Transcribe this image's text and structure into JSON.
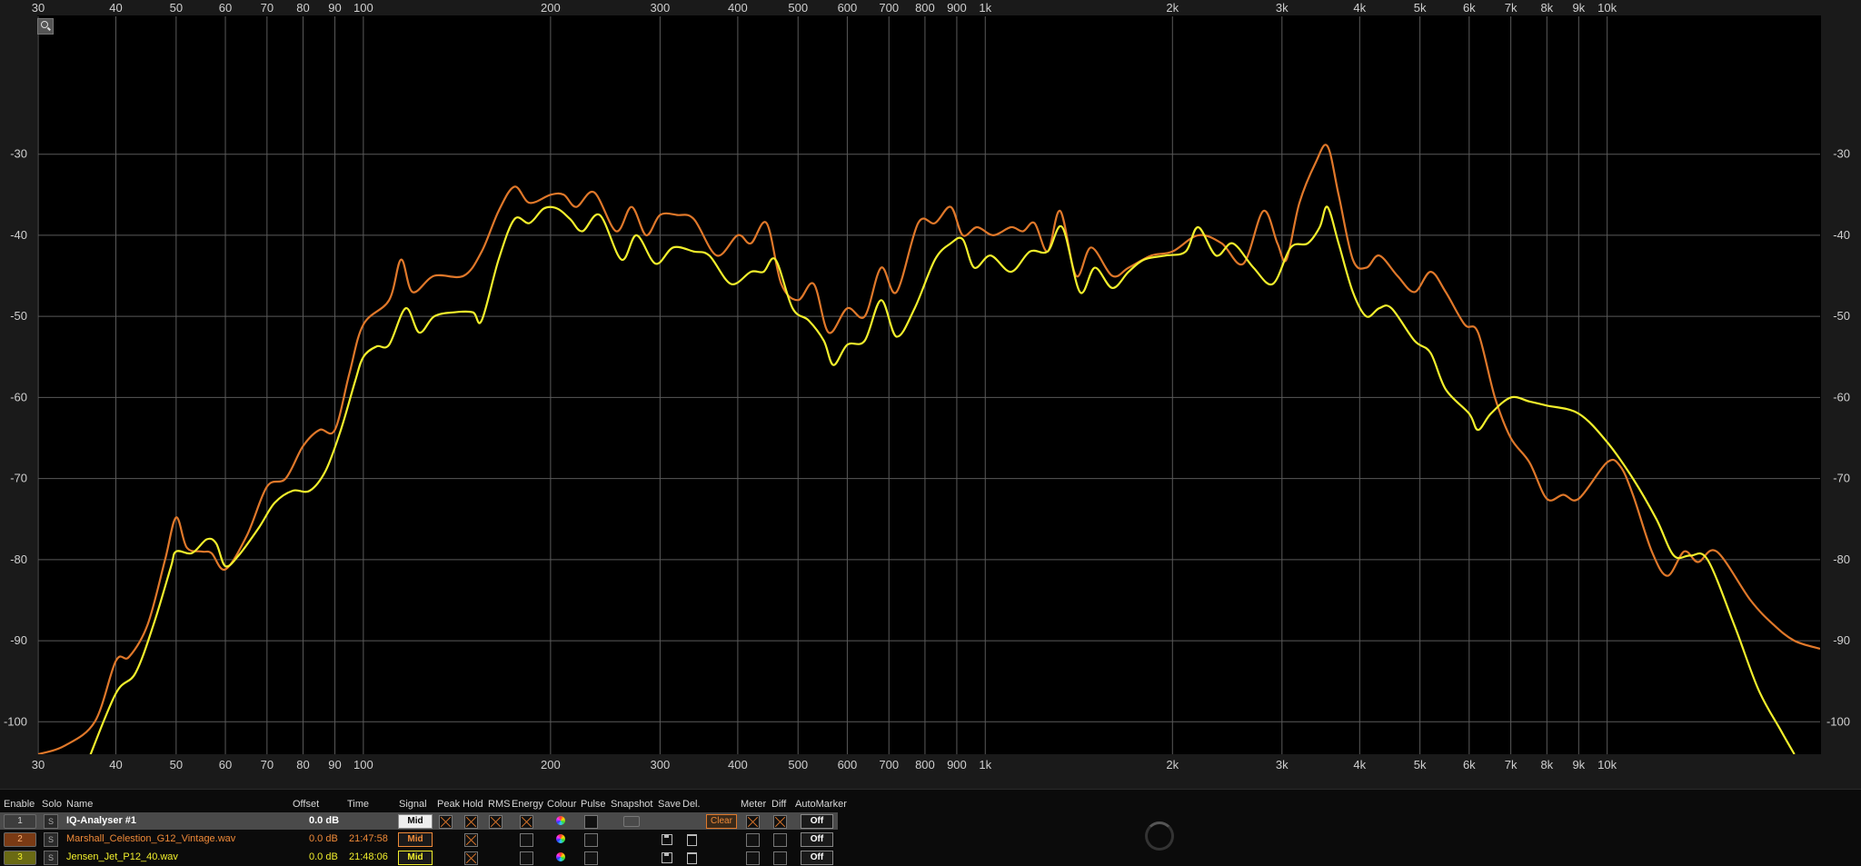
{
  "chart_data": {
    "type": "line",
    "x_scale": "log",
    "xlim": [
      30,
      22000
    ],
    "ylim": [
      -104,
      -13
    ],
    "grid": true,
    "x_ticks": [
      30,
      40,
      50,
      60,
      70,
      80,
      90,
      100,
      200,
      300,
      400,
      500,
      600,
      700,
      800,
      900,
      1000,
      2000,
      3000,
      4000,
      5000,
      6000,
      7000,
      8000,
      9000,
      10000
    ],
    "x_tick_labels": [
      "30",
      "40",
      "50",
      "60",
      "70",
      "80",
      "90",
      "100",
      "200",
      "300",
      "400",
      "500",
      "600",
      "700",
      "800",
      "900",
      "1k",
      "2k",
      "3k",
      "4k",
      "5k",
      "6k",
      "7k",
      "8k",
      "9k",
      "10k"
    ],
    "y_ticks": [
      -30,
      -40,
      -50,
      -60,
      -70,
      -80,
      -90,
      -100
    ],
    "y_tick_labels": [
      "-30",
      "-40",
      "-50",
      "-60",
      "-70",
      "-80",
      "-90",
      "-100"
    ],
    "series": [
      {
        "name": "Marshall_Celestion_G12_Vintage.wav",
        "color": "#e0782a",
        "points": [
          [
            30,
            -104
          ],
          [
            33,
            -103
          ],
          [
            37,
            -100
          ],
          [
            40,
            -92.5
          ],
          [
            42,
            -92
          ],
          [
            45,
            -88
          ],
          [
            48,
            -80
          ],
          [
            50,
            -74.8
          ],
          [
            52,
            -78.5
          ],
          [
            55,
            -79
          ],
          [
            57,
            -79.2
          ],
          [
            60,
            -81.2
          ],
          [
            65,
            -77
          ],
          [
            70,
            -71
          ],
          [
            75,
            -70
          ],
          [
            80,
            -66
          ],
          [
            85,
            -64
          ],
          [
            90,
            -64
          ],
          [
            95,
            -57
          ],
          [
            100,
            -51
          ],
          [
            110,
            -48
          ],
          [
            115,
            -43
          ],
          [
            120,
            -47
          ],
          [
            130,
            -45
          ],
          [
            145,
            -45
          ],
          [
            155,
            -42
          ],
          [
            165,
            -37
          ],
          [
            175,
            -34
          ],
          [
            185,
            -36
          ],
          [
            200,
            -35
          ],
          [
            210,
            -35
          ],
          [
            220,
            -36.5
          ],
          [
            235,
            -34.7
          ],
          [
            255,
            -39.5
          ],
          [
            270,
            -36.5
          ],
          [
            285,
            -40
          ],
          [
            300,
            -37.5
          ],
          [
            320,
            -37.5
          ],
          [
            340,
            -38
          ],
          [
            370,
            -42.5
          ],
          [
            400,
            -40
          ],
          [
            420,
            -41
          ],
          [
            445,
            -38.5
          ],
          [
            470,
            -46
          ],
          [
            500,
            -48
          ],
          [
            530,
            -46
          ],
          [
            560,
            -52
          ],
          [
            600,
            -49
          ],
          [
            640,
            -50
          ],
          [
            680,
            -44
          ],
          [
            720,
            -47
          ],
          [
            780,
            -38.5
          ],
          [
            830,
            -38.5
          ],
          [
            880,
            -36.5
          ],
          [
            920,
            -40
          ],
          [
            970,
            -39
          ],
          [
            1030,
            -40
          ],
          [
            1100,
            -39
          ],
          [
            1150,
            -39.5
          ],
          [
            1200,
            -38.5
          ],
          [
            1260,
            -42
          ],
          [
            1320,
            -37
          ],
          [
            1400,
            -45
          ],
          [
            1480,
            -41.5
          ],
          [
            1600,
            -45
          ],
          [
            1700,
            -44
          ],
          [
            1850,
            -42.5
          ],
          [
            2000,
            -42
          ],
          [
            2200,
            -40
          ],
          [
            2400,
            -41
          ],
          [
            2600,
            -43.5
          ],
          [
            2800,
            -37
          ],
          [
            2950,
            -41
          ],
          [
            3050,
            -43
          ],
          [
            3200,
            -36
          ],
          [
            3400,
            -31
          ],
          [
            3550,
            -29
          ],
          [
            3700,
            -35
          ],
          [
            3900,
            -43
          ],
          [
            4100,
            -44
          ],
          [
            4300,
            -42.5
          ],
          [
            4600,
            -45
          ],
          [
            4900,
            -47
          ],
          [
            5200,
            -44.5
          ],
          [
            5500,
            -47
          ],
          [
            5900,
            -51
          ],
          [
            6200,
            -52
          ],
          [
            6600,
            -60
          ],
          [
            7000,
            -65
          ],
          [
            7500,
            -68
          ],
          [
            8000,
            -72.5
          ],
          [
            8500,
            -72
          ],
          [
            9000,
            -72.5
          ],
          [
            10000,
            -68
          ],
          [
            10500,
            -68.5
          ],
          [
            11000,
            -72
          ],
          [
            11800,
            -79
          ],
          [
            12500,
            -82
          ],
          [
            13300,
            -79
          ],
          [
            14000,
            -80.3
          ],
          [
            15000,
            -79
          ],
          [
            17000,
            -85
          ],
          [
            18500,
            -88
          ],
          [
            20000,
            -90
          ],
          [
            22000,
            -91
          ]
        ]
      },
      {
        "name": "Jensen_Jet_P12_40.wav",
        "color": "#f2ef2c",
        "points": [
          [
            36,
            -105
          ],
          [
            40,
            -96.5
          ],
          [
            43,
            -94
          ],
          [
            46,
            -88
          ],
          [
            49,
            -81
          ],
          [
            50,
            -79
          ],
          [
            53,
            -79.2
          ],
          [
            56,
            -77.5
          ],
          [
            58,
            -78
          ],
          [
            60,
            -80.8
          ],
          [
            63,
            -79.5
          ],
          [
            68,
            -76
          ],
          [
            72,
            -73
          ],
          [
            77,
            -71.5
          ],
          [
            82,
            -71.5
          ],
          [
            87,
            -69
          ],
          [
            92,
            -64
          ],
          [
            97,
            -58
          ],
          [
            100,
            -55
          ],
          [
            105,
            -53.7
          ],
          [
            110,
            -53.5
          ],
          [
            117,
            -49
          ],
          [
            123,
            -52
          ],
          [
            130,
            -50
          ],
          [
            140,
            -49.5
          ],
          [
            150,
            -49.5
          ],
          [
            155,
            -50.5
          ],
          [
            165,
            -43
          ],
          [
            175,
            -38
          ],
          [
            185,
            -38.5
          ],
          [
            195,
            -36.7
          ],
          [
            205,
            -36.7
          ],
          [
            215,
            -38
          ],
          [
            225,
            -39.5
          ],
          [
            240,
            -37.5
          ],
          [
            260,
            -43
          ],
          [
            275,
            -40
          ],
          [
            295,
            -43.5
          ],
          [
            315,
            -41.5
          ],
          [
            340,
            -42
          ],
          [
            360,
            -42.5
          ],
          [
            390,
            -46
          ],
          [
            420,
            -44.5
          ],
          [
            440,
            -44.5
          ],
          [
            460,
            -43
          ],
          [
            490,
            -49
          ],
          [
            520,
            -50.5
          ],
          [
            550,
            -53
          ],
          [
            570,
            -56
          ],
          [
            600,
            -53.5
          ],
          [
            640,
            -53
          ],
          [
            680,
            -48
          ],
          [
            720,
            -52.5
          ],
          [
            770,
            -49
          ],
          [
            830,
            -43
          ],
          [
            880,
            -41
          ],
          [
            920,
            -40.5
          ],
          [
            960,
            -44
          ],
          [
            1020,
            -42.5
          ],
          [
            1100,
            -44.5
          ],
          [
            1180,
            -42
          ],
          [
            1260,
            -42
          ],
          [
            1330,
            -39
          ],
          [
            1420,
            -47
          ],
          [
            1500,
            -44
          ],
          [
            1600,
            -46.5
          ],
          [
            1700,
            -44.5
          ],
          [
            1800,
            -43
          ],
          [
            1950,
            -42.5
          ],
          [
            2100,
            -42
          ],
          [
            2200,
            -39
          ],
          [
            2350,
            -42.5
          ],
          [
            2500,
            -41
          ],
          [
            2700,
            -44
          ],
          [
            2900,
            -46
          ],
          [
            3100,
            -41.5
          ],
          [
            3300,
            -41
          ],
          [
            3450,
            -39
          ],
          [
            3550,
            -36.5
          ],
          [
            3700,
            -41
          ],
          [
            3900,
            -47
          ],
          [
            4100,
            -50
          ],
          [
            4300,
            -49
          ],
          [
            4500,
            -49
          ],
          [
            4900,
            -53
          ],
          [
            5200,
            -54.5
          ],
          [
            5500,
            -59
          ],
          [
            6000,
            -62
          ],
          [
            6200,
            -64
          ],
          [
            6500,
            -62
          ],
          [
            7000,
            -60
          ],
          [
            7500,
            -60.5
          ],
          [
            8000,
            -61
          ],
          [
            9000,
            -62
          ],
          [
            10000,
            -65.5
          ],
          [
            11000,
            -70
          ],
          [
            12000,
            -75
          ],
          [
            12800,
            -79.5
          ],
          [
            13600,
            -79.5
          ],
          [
            14500,
            -80
          ],
          [
            16000,
            -88
          ],
          [
            17500,
            -96
          ],
          [
            19000,
            -101
          ],
          [
            20000,
            -104
          ]
        ]
      }
    ]
  },
  "panel": {
    "headers": {
      "enable": "Enable",
      "solo": "Solo",
      "name": "Name",
      "offset": "Offset",
      "time": "Time",
      "signal": "Signal",
      "peak": "Peak",
      "hold": "Hold",
      "rms": "RMS",
      "energy": "Energy",
      "colour": "Colour",
      "pulse": "Pulse",
      "snapshot": "Snapshot",
      "save": "Save",
      "del": "Del.",
      "meter": "Meter",
      "diff": "Diff",
      "automarker": "AutoMarker"
    },
    "rows": [
      {
        "index": "1",
        "solo": "S",
        "name": "IQ-Analyser #1",
        "offset": "0.0 dB",
        "time": "",
        "signal": "Mid",
        "clear": "Clear",
        "automarker": "Off",
        "color": "#ffffff"
      },
      {
        "index": "2",
        "solo": "S",
        "name": "Marshall_Celestion_G12_Vintage.wav",
        "offset": "0.0 dB",
        "time": "21:47:58",
        "signal": "Mid",
        "automarker": "Off",
        "color": "#f08a38"
      },
      {
        "index": "3",
        "solo": "S",
        "name": "Jensen_Jet_P12_40.wav",
        "offset": "0.0 dB",
        "time": "21:48:06",
        "signal": "Mid",
        "automarker": "Off",
        "color": "#f2ef2c"
      }
    ]
  }
}
